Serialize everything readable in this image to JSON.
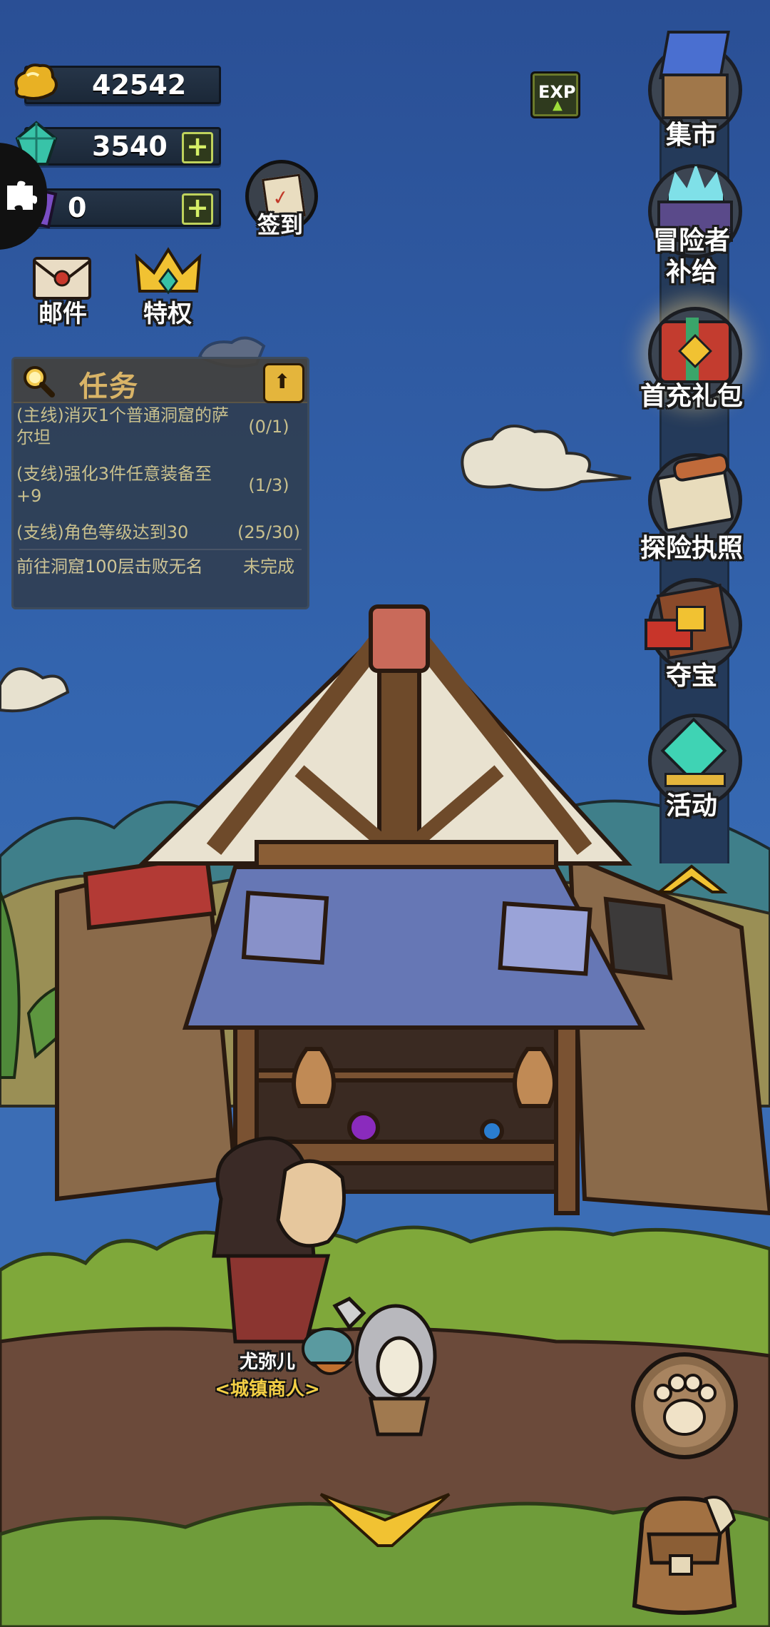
{
  "currencies": {
    "gold": {
      "value": "42542",
      "icon": "gold-nugget-icon"
    },
    "gems": {
      "value": "3540",
      "icon": "green-gem-icon"
    },
    "tickets": {
      "value": "0",
      "icon": "purple-ticket-icon"
    }
  },
  "buttons": {
    "checkin": "签到",
    "mail": "邮件",
    "privilege": "特权",
    "exp": "EXP"
  },
  "quest_panel": {
    "title": "任务",
    "quests": [
      {
        "text": "(主线)消灭1个普通洞窟的萨尔坦",
        "progress": "(0/1)"
      },
      {
        "text": "(支线)强化3件任意装备至+9",
        "progress": "(1/3)"
      },
      {
        "text": "(支线)角色等级达到30",
        "progress": "(25/30)"
      },
      {
        "text": "前往洞窟100层击败无名",
        "progress": "未完成"
      }
    ]
  },
  "side_menu": {
    "market": "集市",
    "supply_line1": "冒险者",
    "supply_line2": "补给",
    "first_charge": "首充礼包",
    "license": "探险执照",
    "treasure": "夺宝",
    "activity": "活动"
  },
  "npc": {
    "name": "尤弥儿",
    "title": "<城镇商人>"
  },
  "colors": {
    "sky": "#2f5fae",
    "grass": "#7fa83a",
    "dirt": "#6b4a3a",
    "panel": "#303a48"
  }
}
